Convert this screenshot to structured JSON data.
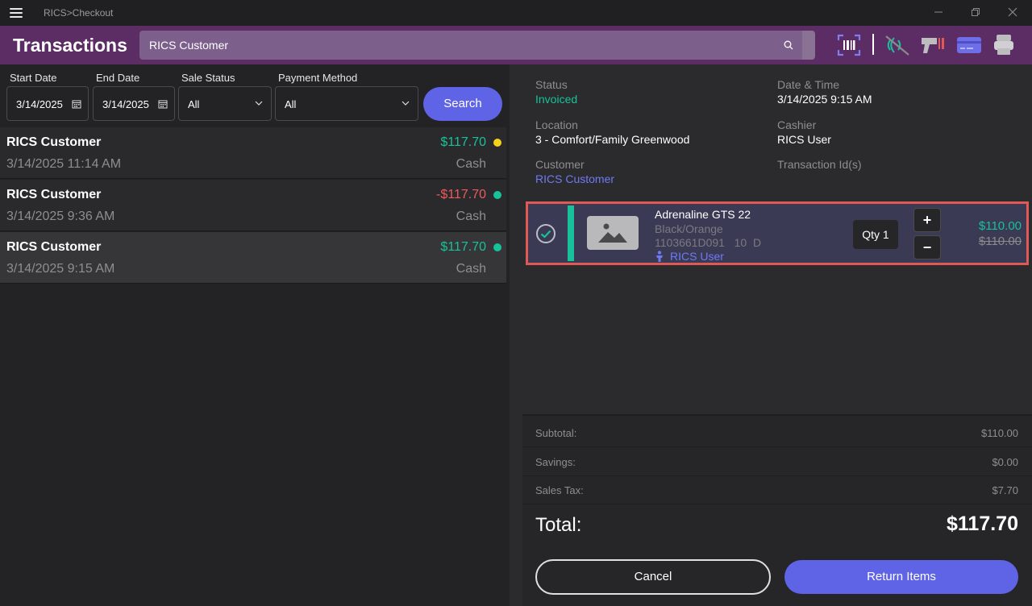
{
  "app": {
    "title": "RICS>Checkout"
  },
  "header": {
    "title": "Transactions",
    "search_value": "RICS Customer"
  },
  "filters": {
    "start_date_label": "Start Date",
    "start_date_value": "3/14/2025",
    "end_date_label": "End Date",
    "end_date_value": "3/14/2025",
    "sale_status_label": "Sale Status",
    "sale_status_value": "All",
    "payment_method_label": "Payment Method",
    "payment_method_value": "All",
    "search_button": "Search"
  },
  "transactions": [
    {
      "customer": "RICS Customer",
      "date": "3/14/2025 11:14 AM",
      "amount": "$117.70",
      "method": "Cash",
      "amount_color": "#17c29a",
      "dot_color": "#f2d21b"
    },
    {
      "customer": "RICS Customer",
      "date": "3/14/2025 9:36 AM",
      "amount": "-$117.70",
      "method": "Cash",
      "amount_color": "#ef5a5a",
      "dot_color": "#17c29a"
    },
    {
      "customer": "RICS Customer",
      "date": "3/14/2025 9:15 AM",
      "amount": "$117.70",
      "method": "Cash",
      "amount_color": "#17c29a",
      "dot_color": "#17c29a"
    }
  ],
  "details": {
    "status_label": "Status",
    "status_value": "Invoiced",
    "datetime_label": "Date & Time",
    "datetime_value": "3/14/2025 9:15 AM",
    "location_label": "Location",
    "location_value": "3 - Comfort/Family Greenwood",
    "cashier_label": "Cashier",
    "cashier_value": "RICS User",
    "customer_label": "Customer",
    "customer_value": "RICS Customer",
    "transaction_id_label": "Transaction Id(s)"
  },
  "item": {
    "name": "Adrenaline GTS 22",
    "color": "Black/Orange",
    "sku": "1103661D091   10  D",
    "user": "RICS User",
    "qty": "Qty 1",
    "plus": "+",
    "minus": "−",
    "price": "$110.00",
    "original_price": "$110.00"
  },
  "summary": {
    "subtotal_label": "Subtotal:",
    "subtotal_value": "$110.00",
    "savings_label": "Savings:",
    "savings_value": "$0.00",
    "tax_label": "Sales Tax:",
    "tax_value": "$7.70",
    "total_label": "Total:",
    "total_value": "$117.70"
  },
  "actions": {
    "cancel": "Cancel",
    "return": "Return Items"
  },
  "colors": {
    "accent": "#5f63e6",
    "header": "#5c2c64",
    "positive": "#17c29a",
    "negative": "#ef5a5a",
    "link": "#6f7af2"
  }
}
